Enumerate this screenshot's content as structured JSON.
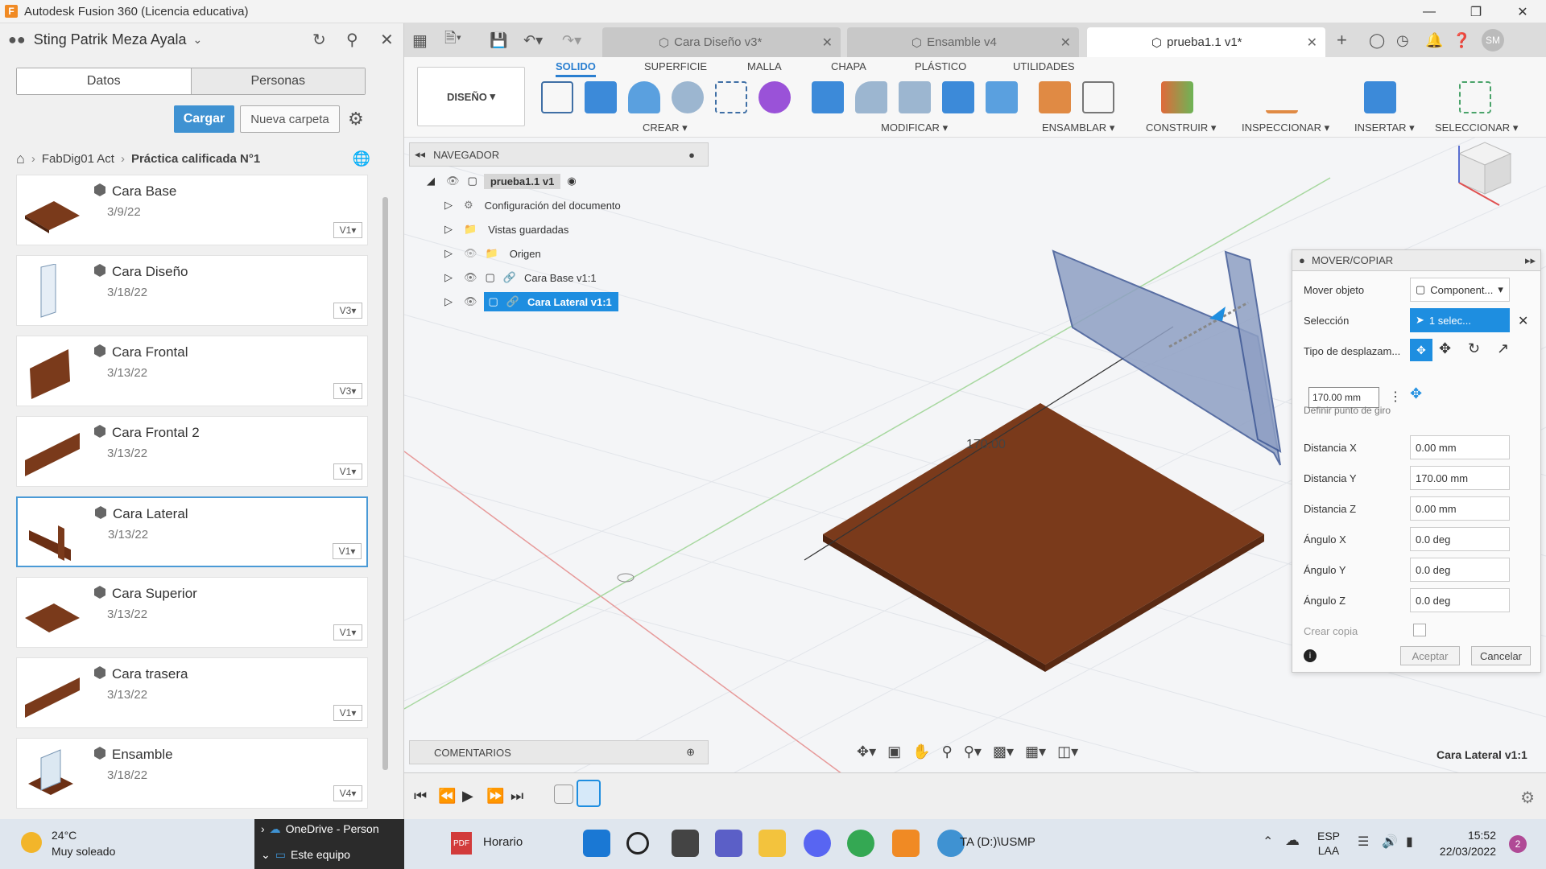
{
  "titlebar": {
    "title": "Autodesk Fusion 360 (Licencia educativa)",
    "logo": "F"
  },
  "user": {
    "name": "Sting Patrik Meza Ayala"
  },
  "datapanel": {
    "tabs": [
      "Datos",
      "Personas"
    ],
    "upload_label": "Cargar",
    "new_folder_label": "Nueva carpeta",
    "breadcrumb": [
      "FabDig01 Act",
      "Práctica calificada N°1"
    ]
  },
  "files": [
    {
      "name": "Cara Base",
      "date": "3/9/22",
      "version": "V1"
    },
    {
      "name": "Cara Diseño",
      "date": "3/18/22",
      "version": "V3"
    },
    {
      "name": "Cara Frontal",
      "date": "3/13/22",
      "version": "V3"
    },
    {
      "name": "Cara Frontal 2",
      "date": "3/13/22",
      "version": "V1"
    },
    {
      "name": "Cara Lateral",
      "date": "3/13/22",
      "version": "V1"
    },
    {
      "name": "Cara Superior",
      "date": "3/13/22",
      "version": "V1"
    },
    {
      "name": "Cara trasera",
      "date": "3/13/22",
      "version": "V1"
    },
    {
      "name": "Ensamble",
      "date": "3/18/22",
      "version": "V4"
    }
  ],
  "doc_tabs": [
    {
      "label": "Cara Diseño v3*"
    },
    {
      "label": "Ensamble v4"
    },
    {
      "label": "prueba1.1 v1*"
    }
  ],
  "user_initials": "SM",
  "ribbon": {
    "workspace": "DISEÑO",
    "tabs": [
      "SOLIDO",
      "SUPERFICIE",
      "MALLA",
      "CHAPA",
      "PLÁSTICO",
      "UTILIDADES"
    ],
    "groups": [
      "CREAR",
      "MODIFICAR",
      "ENSAMBLAR",
      "CONSTRUIR",
      "INSPECCIONAR",
      "INSERTAR",
      "SELECCIONAR"
    ]
  },
  "browser": {
    "title": "NAVEGADOR",
    "root": "prueba1.1 v1",
    "items": [
      "Configuración del documento",
      "Vistas guardadas",
      "Origen",
      "Cara Base v1:1",
      "Cara Lateral v1:1"
    ]
  },
  "viewport": {
    "dimension_label": "170.00"
  },
  "move_copy": {
    "title": "MOVER/COPIAR",
    "move_object_label": "Mover objeto",
    "move_object_value": "Component...",
    "selection_label": "Selección",
    "selection_value": "1 selec...",
    "move_type_label": "Tipo de desplazam...",
    "pivot_label": "Definir punto de giro",
    "inline_value": "170.00 mm",
    "fields": [
      {
        "label": "Distancia X",
        "value": "0.00 mm"
      },
      {
        "label": "Distancia Y",
        "value": "170.00 mm"
      },
      {
        "label": "Distancia Z",
        "value": "0.00 mm"
      },
      {
        "label": "Ángulo X",
        "value": "0.0 deg"
      },
      {
        "label": "Ángulo Y",
        "value": "0.0 deg"
      },
      {
        "label": "Ángulo Z",
        "value": "0.0 deg"
      }
    ],
    "create_copy_label": "Crear copia",
    "ok_label": "Aceptar",
    "cancel_label": "Cancelar"
  },
  "comments_label": "COMENTARIOS",
  "status_selection": "Cara Lateral v1:1",
  "taskbar": {
    "weather_temp": "24°C",
    "weather_desc": "Muy soleado",
    "onedrive": "OneDrive - Person",
    "this_pc": "Este equipo",
    "horario": "Horario",
    "ta_label": "TA (D:)\\USMP",
    "lang1": "ESP",
    "lang2": "LAA",
    "time": "15:52",
    "date": "22/03/2022",
    "notif_count": "2"
  },
  "colors": {
    "accent": "#3f92d2",
    "wood": "#7a3a1b",
    "selection": "#1e8ee0"
  }
}
